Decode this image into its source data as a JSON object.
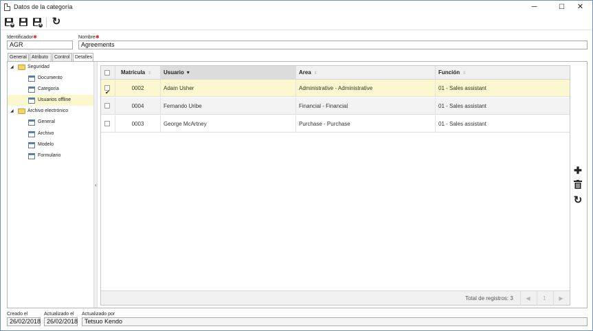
{
  "window": {
    "title": "Datos de la categoría",
    "minimize": "─",
    "maximize": "☐",
    "close": "✕"
  },
  "toolbar": {
    "buttons": [
      "save-new-icon",
      "save-icon",
      "save-close-icon",
      "refresh-icon"
    ],
    "refresh_glyph": "↻"
  },
  "form": {
    "identifier_label": "Identificador",
    "identifier_value": "AGR",
    "name_label": "Nombre",
    "name_value": "Agreements",
    "required_mark": "✱"
  },
  "tabs": [
    {
      "label": "General",
      "active": false
    },
    {
      "label": "Atributo",
      "active": false
    },
    {
      "label": "Control",
      "active": false
    },
    {
      "label": "Detalles",
      "active": true
    }
  ],
  "tree": {
    "groups": [
      {
        "label": "Seguridad",
        "expanded": true,
        "children": [
          {
            "label": "Documento",
            "selected": false
          },
          {
            "label": "Categoría",
            "selected": false
          },
          {
            "label": "Usuarios offline",
            "selected": true
          }
        ]
      },
      {
        "label": "Archivo electrónico",
        "expanded": true,
        "children": [
          {
            "label": "General",
            "selected": false
          },
          {
            "label": "Archivo",
            "selected": false
          },
          {
            "label": "Modelo",
            "selected": false
          },
          {
            "label": "Formulario",
            "selected": false
          }
        ]
      }
    ],
    "collapse_glyph": "◢",
    "splitter_glyph": "‹"
  },
  "grid": {
    "columns": [
      {
        "label": "Matrícula",
        "sort": "none"
      },
      {
        "label": "Usuario",
        "sort": "desc"
      },
      {
        "label": "Area",
        "sort": "none"
      },
      {
        "label": "Función",
        "sort": "none"
      }
    ],
    "sort_none_glyph": "⇕",
    "sort_desc_glyph": "▾",
    "rows": [
      {
        "checked": true,
        "matricula": "0002",
        "usuario": "Adam Usher",
        "area": "Administrative - Administrative",
        "funcion": "01 - Sales assistant"
      },
      {
        "checked": false,
        "matricula": "0004",
        "usuario": "Fernando Uribe",
        "area": "Financial - Financial",
        "funcion": "01 - Sales assistant"
      },
      {
        "checked": false,
        "matricula": "0003",
        "usuario": "George McArtney",
        "area": "Purchase - Purchase",
        "funcion": "01 - Sales assistant"
      }
    ],
    "total_label": "Total de registros: 3",
    "page": "1",
    "prev_glyph": "◀",
    "next_glyph": "▶"
  },
  "side_actions": {
    "add_glyph": "✚",
    "delete_glyph": "🗑",
    "refresh_glyph": "↻"
  },
  "footer": {
    "created_label": "Creado el",
    "created_value": "26/02/2018",
    "updated_label": "Actualizado el",
    "updated_value": "26/02/2018",
    "updated_by_label": "Actualizado por",
    "updated_by_value": "Tetsuo Kendo"
  }
}
